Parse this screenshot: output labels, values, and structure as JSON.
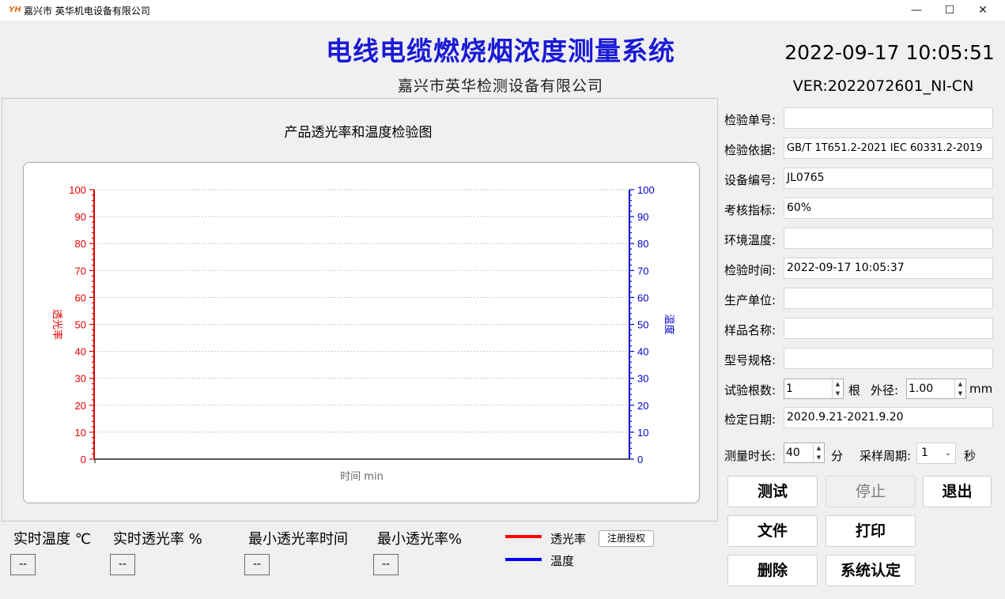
{
  "window": {
    "icon_text": "YH",
    "title": "嘉兴市 英华机电设备有限公司",
    "min_glyph": "—",
    "max_glyph": "☐",
    "close_glyph": "✕"
  },
  "header": {
    "title": "电线电缆燃烧烟浓度测量系统",
    "company": "嘉兴市英华检测设备有限公司",
    "datetime": "2022-09-17 10:05:51",
    "version": "VER:2022072601_NI-CN"
  },
  "chart_data": {
    "type": "line",
    "title": "产品透光率和温度检验图",
    "xlabel": "时间 min",
    "ylabel": "透光率",
    "y2label": "温度",
    "ylim": [
      0,
      100
    ],
    "y2lim": [
      0,
      100
    ],
    "yticks": [
      "0",
      "10",
      "20",
      "30",
      "40",
      "50",
      "60",
      "70",
      "80",
      "90",
      "100"
    ],
    "y2ticks": [
      "0",
      "10",
      "20",
      "30",
      "40",
      "50",
      "60",
      "70",
      "80",
      "90",
      "100"
    ],
    "grid": true,
    "series": [],
    "colors": {
      "left_axis": "#e00000",
      "right_axis": "#0000cc",
      "grid": "#c8c8c8"
    }
  },
  "readouts": [
    {
      "label": "实时温度 ℃",
      "value": "--"
    },
    {
      "label": "实时透光率 %",
      "value": "--"
    },
    {
      "label": "最小透光率时间",
      "value": "--"
    },
    {
      "label": "最小透光率%",
      "value": "--"
    }
  ],
  "legend": {
    "items": [
      {
        "label": "透光率",
        "color": "#ff0000"
      },
      {
        "label": "温度",
        "color": "#0000ff"
      }
    ],
    "register_button": "注册授权"
  },
  "form": {
    "fields": [
      {
        "label": "检验单号:",
        "value": ""
      },
      {
        "label": "检验依据:",
        "value": "GB/T 1T651.2-2021  IEC 60331.2-2019"
      },
      {
        "label": "设备编号:",
        "value": "JL0765"
      },
      {
        "label": "考核指标:",
        "value": "60%"
      },
      {
        "label": "环境温度:",
        "value": ""
      },
      {
        "label": "检验时间:",
        "value": "2022-09-17 10:05:37"
      },
      {
        "label": "生产单位:",
        "value": ""
      },
      {
        "label": "样品名称:",
        "value": ""
      },
      {
        "label": "型号规格:",
        "value": ""
      }
    ],
    "count": {
      "label": "试验根数:",
      "value": "1",
      "unit": "根"
    },
    "diameter": {
      "label": "外径:",
      "value": "1.00",
      "unit": "mm"
    },
    "calibration": {
      "label": "检定日期:",
      "value": "2020.9.21-2021.9.20"
    },
    "duration": {
      "label": "测量时长:",
      "value": "40",
      "unit": "分"
    },
    "period": {
      "label": "采样周期:",
      "value": "1",
      "unit": "秒"
    }
  },
  "buttons": {
    "test": "测试",
    "stop": "停止",
    "exit": "退出",
    "file": "文件",
    "print": "打印",
    "delete": "删除",
    "certify": "系统认定"
  }
}
